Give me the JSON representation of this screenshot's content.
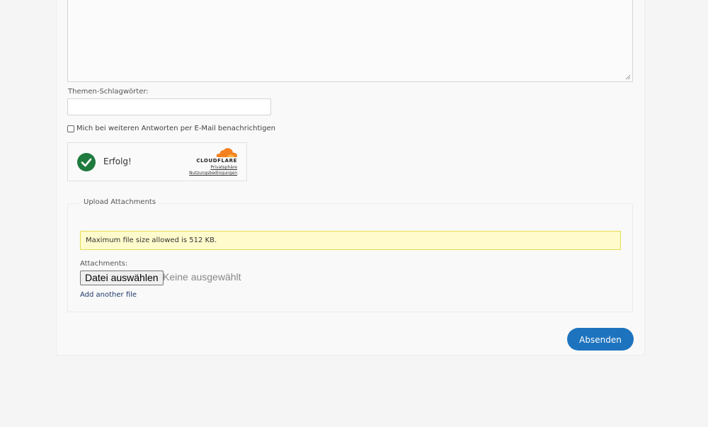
{
  "form": {
    "tags_label": "Themen-Schlagwörter:",
    "tags_value": "",
    "notify_label": "Mich bei weiteren Antworten per E-Mail benachrichtigen",
    "notify_checked": false,
    "submit_label": "Absenden"
  },
  "turnstile": {
    "status": "Erfolg!",
    "brand": "CLOUDFLARE",
    "privacy_link": "Privatsphäre",
    "terms_link": "Nutzungsbedingungen",
    "success_color": "#1f7a3e",
    "brand_color": "#f48120"
  },
  "attachments": {
    "legend": "Upload Attachments",
    "notice": "Maximum file size allowed is 512 KB.",
    "label": "Attachments:",
    "choose_button": "Datei auswählen",
    "file_status": "Keine ausgewählt",
    "add_link": "Add another file"
  }
}
